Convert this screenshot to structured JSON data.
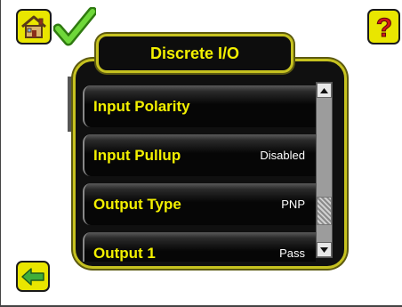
{
  "screen": {
    "title": "Discrete I/O"
  },
  "toolbar": {
    "home_icon": "home-icon",
    "status_icon": "checkmark-icon",
    "help_icon": "question-mark-icon",
    "help_glyph": "?",
    "back_icon": "back-arrow-icon"
  },
  "menu": {
    "items": [
      {
        "label": "Input Polarity",
        "value": ""
      },
      {
        "label": "Input Pullup",
        "value": "Disabled"
      },
      {
        "label": "Output Type",
        "value": "PNP"
      },
      {
        "label": "Output 1",
        "value": "Pass"
      }
    ]
  },
  "scrollbar": {
    "position_fraction": 0.85,
    "visible_fraction": 0.2
  },
  "colors": {
    "accent_yellow": "#F3F000",
    "panel_border": "#C6C220",
    "panel_bg": "#101010",
    "check_green": "#4FC21E"
  }
}
